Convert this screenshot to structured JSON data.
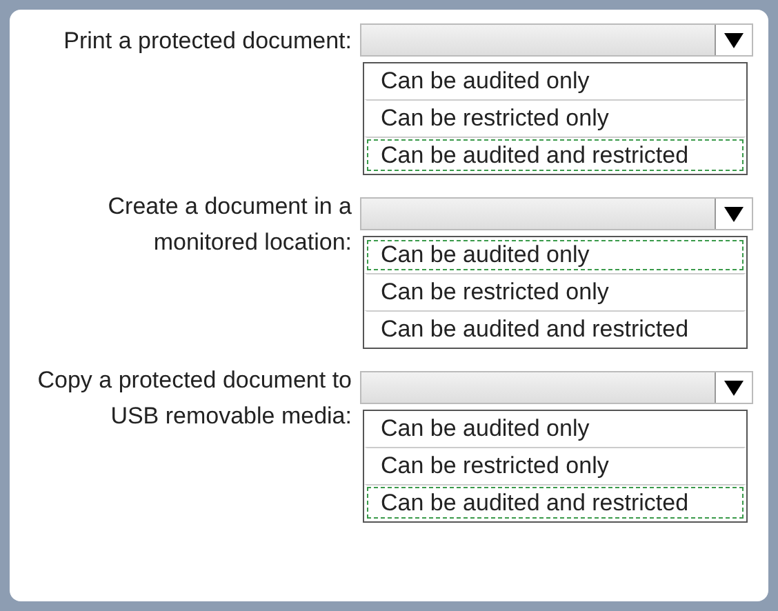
{
  "questions": [
    {
      "label": "Print a protected document:",
      "options": [
        {
          "text": "Can be audited only",
          "selected": false
        },
        {
          "text": "Can be restricted only",
          "selected": false
        },
        {
          "text": "Can be audited and restricted",
          "selected": true
        }
      ]
    },
    {
      "label": "Create a document in a monitored location:",
      "options": [
        {
          "text": "Can be audited only",
          "selected": true
        },
        {
          "text": "Can be restricted only",
          "selected": false
        },
        {
          "text": "Can be audited and restricted",
          "selected": false
        }
      ]
    },
    {
      "label": "Copy a protected document to USB removable media:",
      "options": [
        {
          "text": "Can be audited only",
          "selected": false
        },
        {
          "text": "Can be restricted only",
          "selected": false
        },
        {
          "text": "Can be audited and restricted",
          "selected": true
        }
      ]
    }
  ]
}
